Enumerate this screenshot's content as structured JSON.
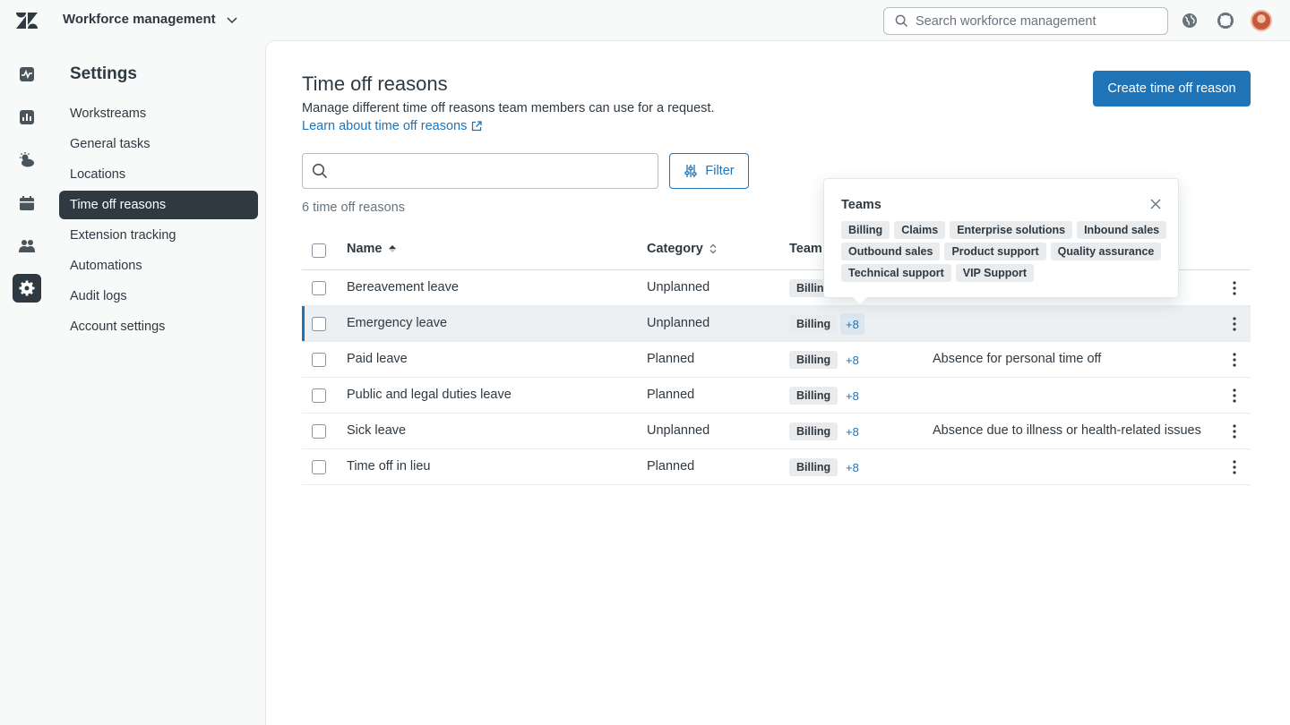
{
  "header": {
    "product_name": "Workforce management",
    "search_placeholder": "Search workforce management"
  },
  "sidebar": {
    "title": "Settings",
    "items": [
      {
        "label": "Workstreams"
      },
      {
        "label": "General tasks"
      },
      {
        "label": "Locations"
      },
      {
        "label": "Time off reasons",
        "active": true
      },
      {
        "label": "Extension tracking"
      },
      {
        "label": "Automations"
      },
      {
        "label": "Audit logs"
      },
      {
        "label": "Account settings"
      }
    ]
  },
  "main": {
    "title": "Time off reasons",
    "description": "Manage different time off reasons team members can use for a request.",
    "learn_link": "Learn about time off reasons",
    "create_button": "Create time off reason",
    "search_placeholder": "",
    "filter_button": "Filter",
    "count_text": "6 time off reasons"
  },
  "table": {
    "headers": {
      "name": "Name",
      "category": "Category",
      "teams": "Team"
    },
    "rows": [
      {
        "name": "Bereavement leave",
        "category": "Unplanned",
        "team": "Billing",
        "more": "",
        "description": ""
      },
      {
        "name": "Emergency leave",
        "category": "Unplanned",
        "team": "Billing",
        "more": "+8",
        "description": ""
      },
      {
        "name": "Paid leave",
        "category": "Planned",
        "team": "Billing",
        "more": "+8",
        "description": "Absence for personal time off"
      },
      {
        "name": "Public and legal duties leave",
        "category": "Planned",
        "team": "Billing",
        "more": "+8",
        "description": ""
      },
      {
        "name": "Sick leave",
        "category": "Unplanned",
        "team": "Billing",
        "more": "+8",
        "description": "Absence due to illness or health-related issues"
      },
      {
        "name": "Time off in lieu",
        "category": "Planned",
        "team": "Billing",
        "more": "+8",
        "description": ""
      }
    ]
  },
  "popover": {
    "title": "Teams",
    "tags": [
      "Billing",
      "Claims",
      "Enterprise solutions",
      "Inbound sales",
      "Outbound sales",
      "Product support",
      "Quality assurance",
      "Technical support",
      "VIP Support"
    ]
  },
  "icons": {
    "logo": "zendesk-logo",
    "rail": [
      "activity-icon",
      "reports-icon",
      "weather-icon",
      "calendar-icon",
      "people-icon",
      "gear-icon"
    ]
  },
  "colors": {
    "accent": "#1f73b7",
    "dark": "#2f3941",
    "tag_bg": "#e9ebed"
  }
}
